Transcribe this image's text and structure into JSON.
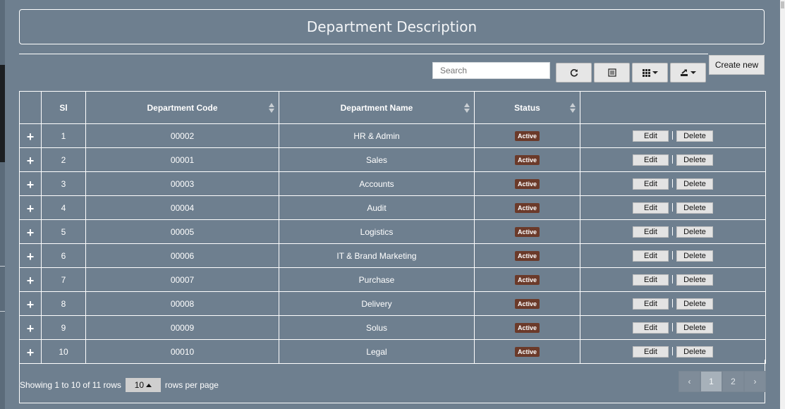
{
  "page": {
    "title": "Department Description"
  },
  "toolbar": {
    "search_placeholder": "Search",
    "create_label": "Create new",
    "refresh_icon": "refresh-icon",
    "toggle_icon": "list-icon",
    "columns_icon": "grid-icon",
    "export_icon": "export-icon"
  },
  "table": {
    "headers": {
      "sl": "Sl",
      "code": "Department Code",
      "name": "Department Name",
      "status": "Status"
    },
    "rows": [
      {
        "sl": "1",
        "code": "00002",
        "name": "HR & Admin",
        "status": "Active"
      },
      {
        "sl": "2",
        "code": "00001",
        "name": "Sales",
        "status": "Active"
      },
      {
        "sl": "3",
        "code": "00003",
        "name": "Accounts",
        "status": "Active"
      },
      {
        "sl": "4",
        "code": "00004",
        "name": "Audit",
        "status": "Active"
      },
      {
        "sl": "5",
        "code": "00005",
        "name": "Logistics",
        "status": "Active"
      },
      {
        "sl": "6",
        "code": "00006",
        "name": "IT & Brand Marketing",
        "status": "Active"
      },
      {
        "sl": "7",
        "code": "00007",
        "name": "Purchase",
        "status": "Active"
      },
      {
        "sl": "8",
        "code": "00008",
        "name": "Delivery",
        "status": "Active"
      },
      {
        "sl": "9",
        "code": "00009",
        "name": "Solus",
        "status": "Active"
      },
      {
        "sl": "10",
        "code": "00010",
        "name": "Legal",
        "status": "Active"
      }
    ],
    "edit_label": "Edit",
    "delete_label": "Delete",
    "expand_symbol": "+"
  },
  "footer": {
    "showing": "Showing 1 to 10 of 11 rows",
    "page_size": "10",
    "rows_per_page": "rows per page",
    "pagination": {
      "prev": "‹",
      "pages": [
        "1",
        "2"
      ],
      "next": "›",
      "current": "1"
    }
  },
  "colors": {
    "background": "#6e7f8f",
    "badge": "#6b3a2a",
    "border": "#ffffff"
  }
}
